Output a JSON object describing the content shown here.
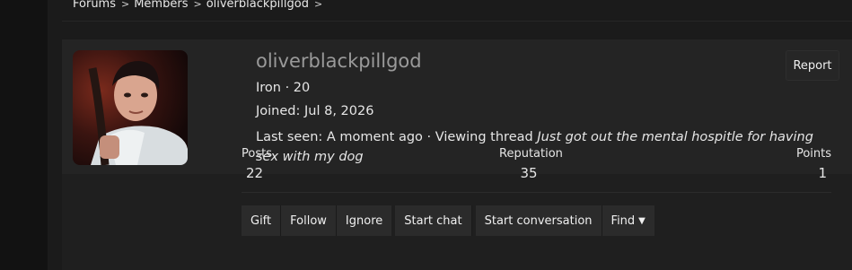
{
  "breadcrumb": {
    "items": [
      "Forums",
      "Members",
      "oliverblackpillgod"
    ],
    "separator": ">"
  },
  "profile": {
    "username": "oliverblackpillgod",
    "rank": "Iron · 20",
    "joined_label": "Joined: Jul 8, 2026",
    "last_seen_prefix": "Last seen: A moment ago · Viewing thread ",
    "last_seen_thread": "Just got out the mental hospitle for having sex with my dog",
    "report_label": "Report"
  },
  "stats": {
    "posts_label": "Posts",
    "posts_value": "22",
    "reputation_label": "Reputation",
    "reputation_value": "35",
    "points_label": "Points",
    "points_value": "1"
  },
  "actions": {
    "gift": "Gift",
    "follow": "Follow",
    "ignore": "Ignore",
    "start_chat": "Start chat",
    "start_conversation": "Start conversation",
    "find": "Find"
  },
  "icons": {
    "breadcrumb_separator": "chevron-right-icon",
    "find_dropdown": "caret-down-icon"
  },
  "colors": {
    "page_bg": "#121212",
    "card_bg": "#242424",
    "username": "#9a9a9a",
    "button_bg": "#2b2b2b",
    "text": "#e6e6e6"
  }
}
